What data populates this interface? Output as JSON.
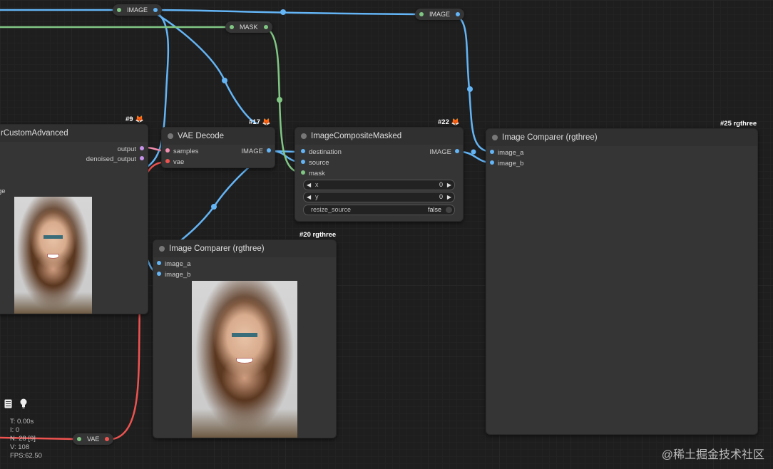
{
  "nodes": {
    "sampler": {
      "title": "rCustomAdvanced",
      "badge": "#9",
      "outputs": [
        "output",
        "denoised_output"
      ],
      "cut_label": "ge"
    },
    "vae_decode": {
      "title": "VAE Decode",
      "badge": "#17",
      "inputs": [
        "samples",
        "vae"
      ],
      "outputs": [
        "IMAGE"
      ]
    },
    "composite": {
      "title": "ImageCompositeMasked",
      "badge": "#22",
      "inputs": [
        "destination",
        "source",
        "mask"
      ],
      "outputs": [
        "IMAGE"
      ],
      "widgets": [
        {
          "label": "x",
          "value": "0"
        },
        {
          "label": "y",
          "value": "0"
        },
        {
          "label": "resize_source",
          "value": "false"
        }
      ]
    },
    "comparer20": {
      "title": "Image Comparer (rgthree)",
      "badge": "#20 rgthree",
      "inputs": [
        "image_a",
        "image_b"
      ]
    },
    "comparer25": {
      "title": "Image Comparer (rgthree)",
      "badge": "#25 rgthree",
      "inputs": [
        "image_a",
        "image_b"
      ]
    }
  },
  "reroutes": {
    "image_top": "IMAGE",
    "mask": "MASK",
    "image_right": "IMAGE",
    "vae": "VAE"
  },
  "stats": {
    "t": "T: 0.00s",
    "i": "I: 0",
    "n": "N: 28 [9]",
    "v": "V: 108",
    "fps": "FPS:62.50"
  },
  "icons": {
    "panel": "panel-icon",
    "bulb": "bulb-icon"
  },
  "watermark": "@稀土掘金技术社区",
  "colors": {
    "image_wire": "#64b5f6",
    "mask_wire": "#81c784",
    "vae_wire": "#ef5350",
    "latent_pin": "#f48fb1"
  }
}
